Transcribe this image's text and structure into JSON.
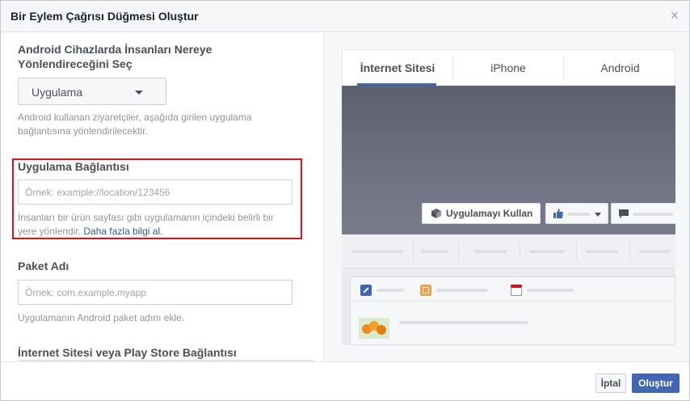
{
  "dialog": {
    "title": "Bir Eylem Çağrısı Düğmesi Oluştur",
    "close_icon": "close-icon",
    "cancel_label": "İptal",
    "create_label": "Oluştur",
    "accent_color": "#4267b2",
    "highlight_color": "#e0101b"
  },
  "left": {
    "android_section": {
      "title_line1": "Android Cihazlarda İnsanları Nereye",
      "title_line2": "Yönlendireceğini Seç",
      "dropdown_value": "Uygulama",
      "helper_line1": "Android kullanan ziyaretçiler, aşağıda girilen uygulama",
      "helper_line2": "bağlantısına yönlendirilecektir."
    },
    "app_link": {
      "title": "Uygulama Bağlantısı",
      "placeholder": "Örnek: example://location/123456",
      "helper_line1": "İnsanları bir ürün sayfası gibi uygulamanın içindeki belirli bir",
      "helper_line2": "yere yönlendir.",
      "learn_more": "Daha fazla bilgi al."
    },
    "package": {
      "title": "Paket Adı",
      "placeholder": "Örnek: com.example.myapp",
      "helper": "Uygulamanın Android paket adını ekle."
    },
    "website_section": {
      "title": "İnternet Sitesi veya Play Store Bağlantısı"
    }
  },
  "preview": {
    "tabs": [
      {
        "label": "İnternet Sitesi",
        "active": true
      },
      {
        "label": "iPhone",
        "active": false
      },
      {
        "label": "Android",
        "active": false
      }
    ],
    "cta_label": "Uygulamayı Kullan",
    "cta_icon": "cube-icon",
    "like_icon": "thumbs-up-icon",
    "message_icon": "message-icon"
  }
}
